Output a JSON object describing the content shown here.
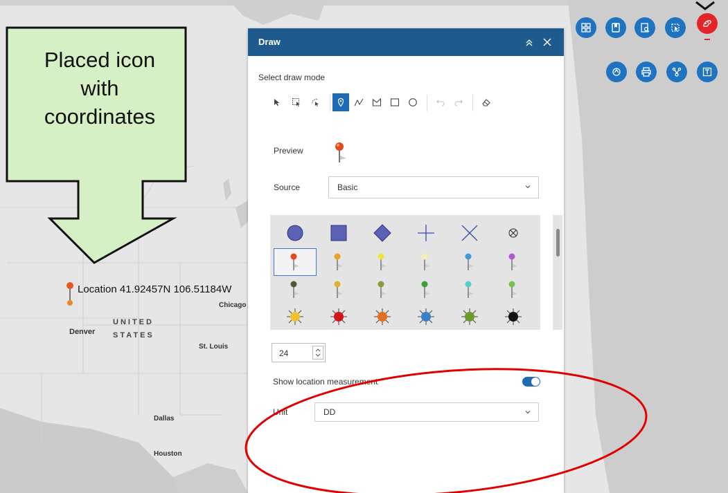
{
  "map": {
    "location_label": "Location 41.92457N 106.51184W",
    "cities": {
      "chicago": "Chicago",
      "denver": "Denver",
      "st_louis": "St. Louis",
      "dallas": "Dallas",
      "houston": "Houston"
    },
    "country_line1": "UNITED",
    "country_line2": "STATES"
  },
  "callout": {
    "line1": "Placed icon",
    "line2": "with",
    "line3": "coordinates"
  },
  "toolbar": {
    "row1": [
      "widgets-icon",
      "bookmark-icon",
      "query-icon",
      "select-icon",
      "draw-icon"
    ],
    "row2": [
      "measure-icon",
      "print-icon",
      "share-icon",
      "text-icon"
    ],
    "accent": "#1f74c1",
    "active_color": "#e3242b"
  },
  "draw_panel": {
    "title": "Draw",
    "select_mode_label": "Select draw mode",
    "preview_label": "Preview",
    "source_label": "Source",
    "source_value": "Basic",
    "size_value": "24",
    "show_location_label": "Show location measurement",
    "show_location_on": true,
    "unit_label": "Unit",
    "unit_value": "DD",
    "header_color": "#1e5a8e"
  },
  "annotation": {
    "callout_fill": "#d4f0c4",
    "ellipse_color": "#e00000"
  }
}
